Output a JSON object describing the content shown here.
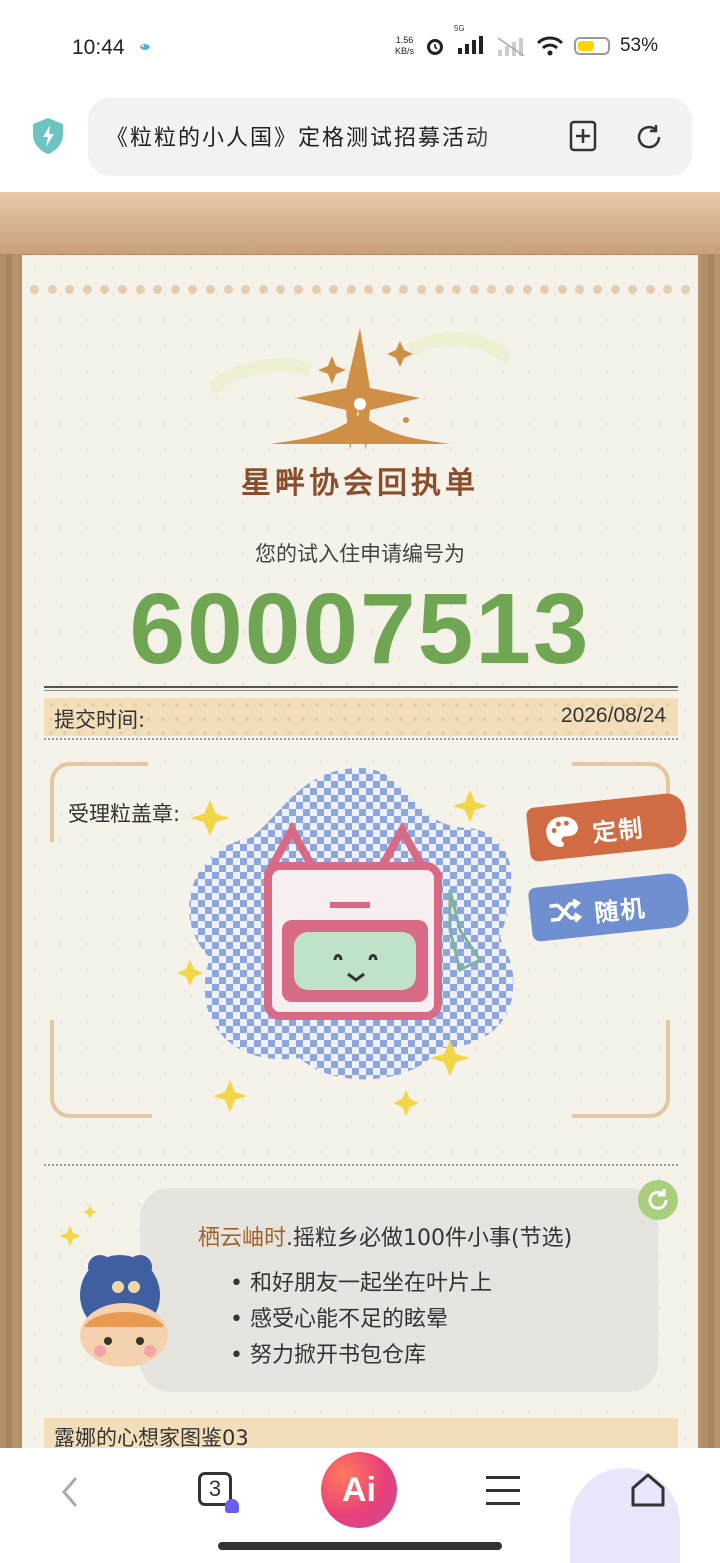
{
  "status_bar": {
    "time": "10:44",
    "net_speed_top": "1.56",
    "net_speed_bottom": "KB/s",
    "network_label": "5G",
    "battery_percent": "53%",
    "battery_level": 0.53,
    "battery_color": "#ffd400"
  },
  "browser": {
    "url_title": "《粒粒的小人国》定格测试招募活动",
    "icons": [
      "shield-bolt-icon",
      "bookmark-add-icon",
      "refresh-icon"
    ]
  },
  "receipt": {
    "logo_title": "星畔协会回执单",
    "id_label": "您的试入住申请编号为",
    "id_number": "60007513",
    "accent_color": "#6fa553",
    "submit_label": "提交时间:",
    "submit_date": "2026/08/24",
    "stamp_label": "受理粒盖章:",
    "custom_button": "定制",
    "random_button": "随机"
  },
  "todo_card": {
    "title_accent": "栖云岫时",
    "title_rest": ".摇粒乡必做100件小事(节选)",
    "items": [
      "和好朋友一起坐在叶片上",
      "感受心能不足的眩晕",
      "努力掀开书包仓库"
    ]
  },
  "gallery": {
    "title": "露娜的心想家图鉴03"
  },
  "bottom_nav": {
    "tab_count": "3",
    "ai_label": "Ai"
  }
}
